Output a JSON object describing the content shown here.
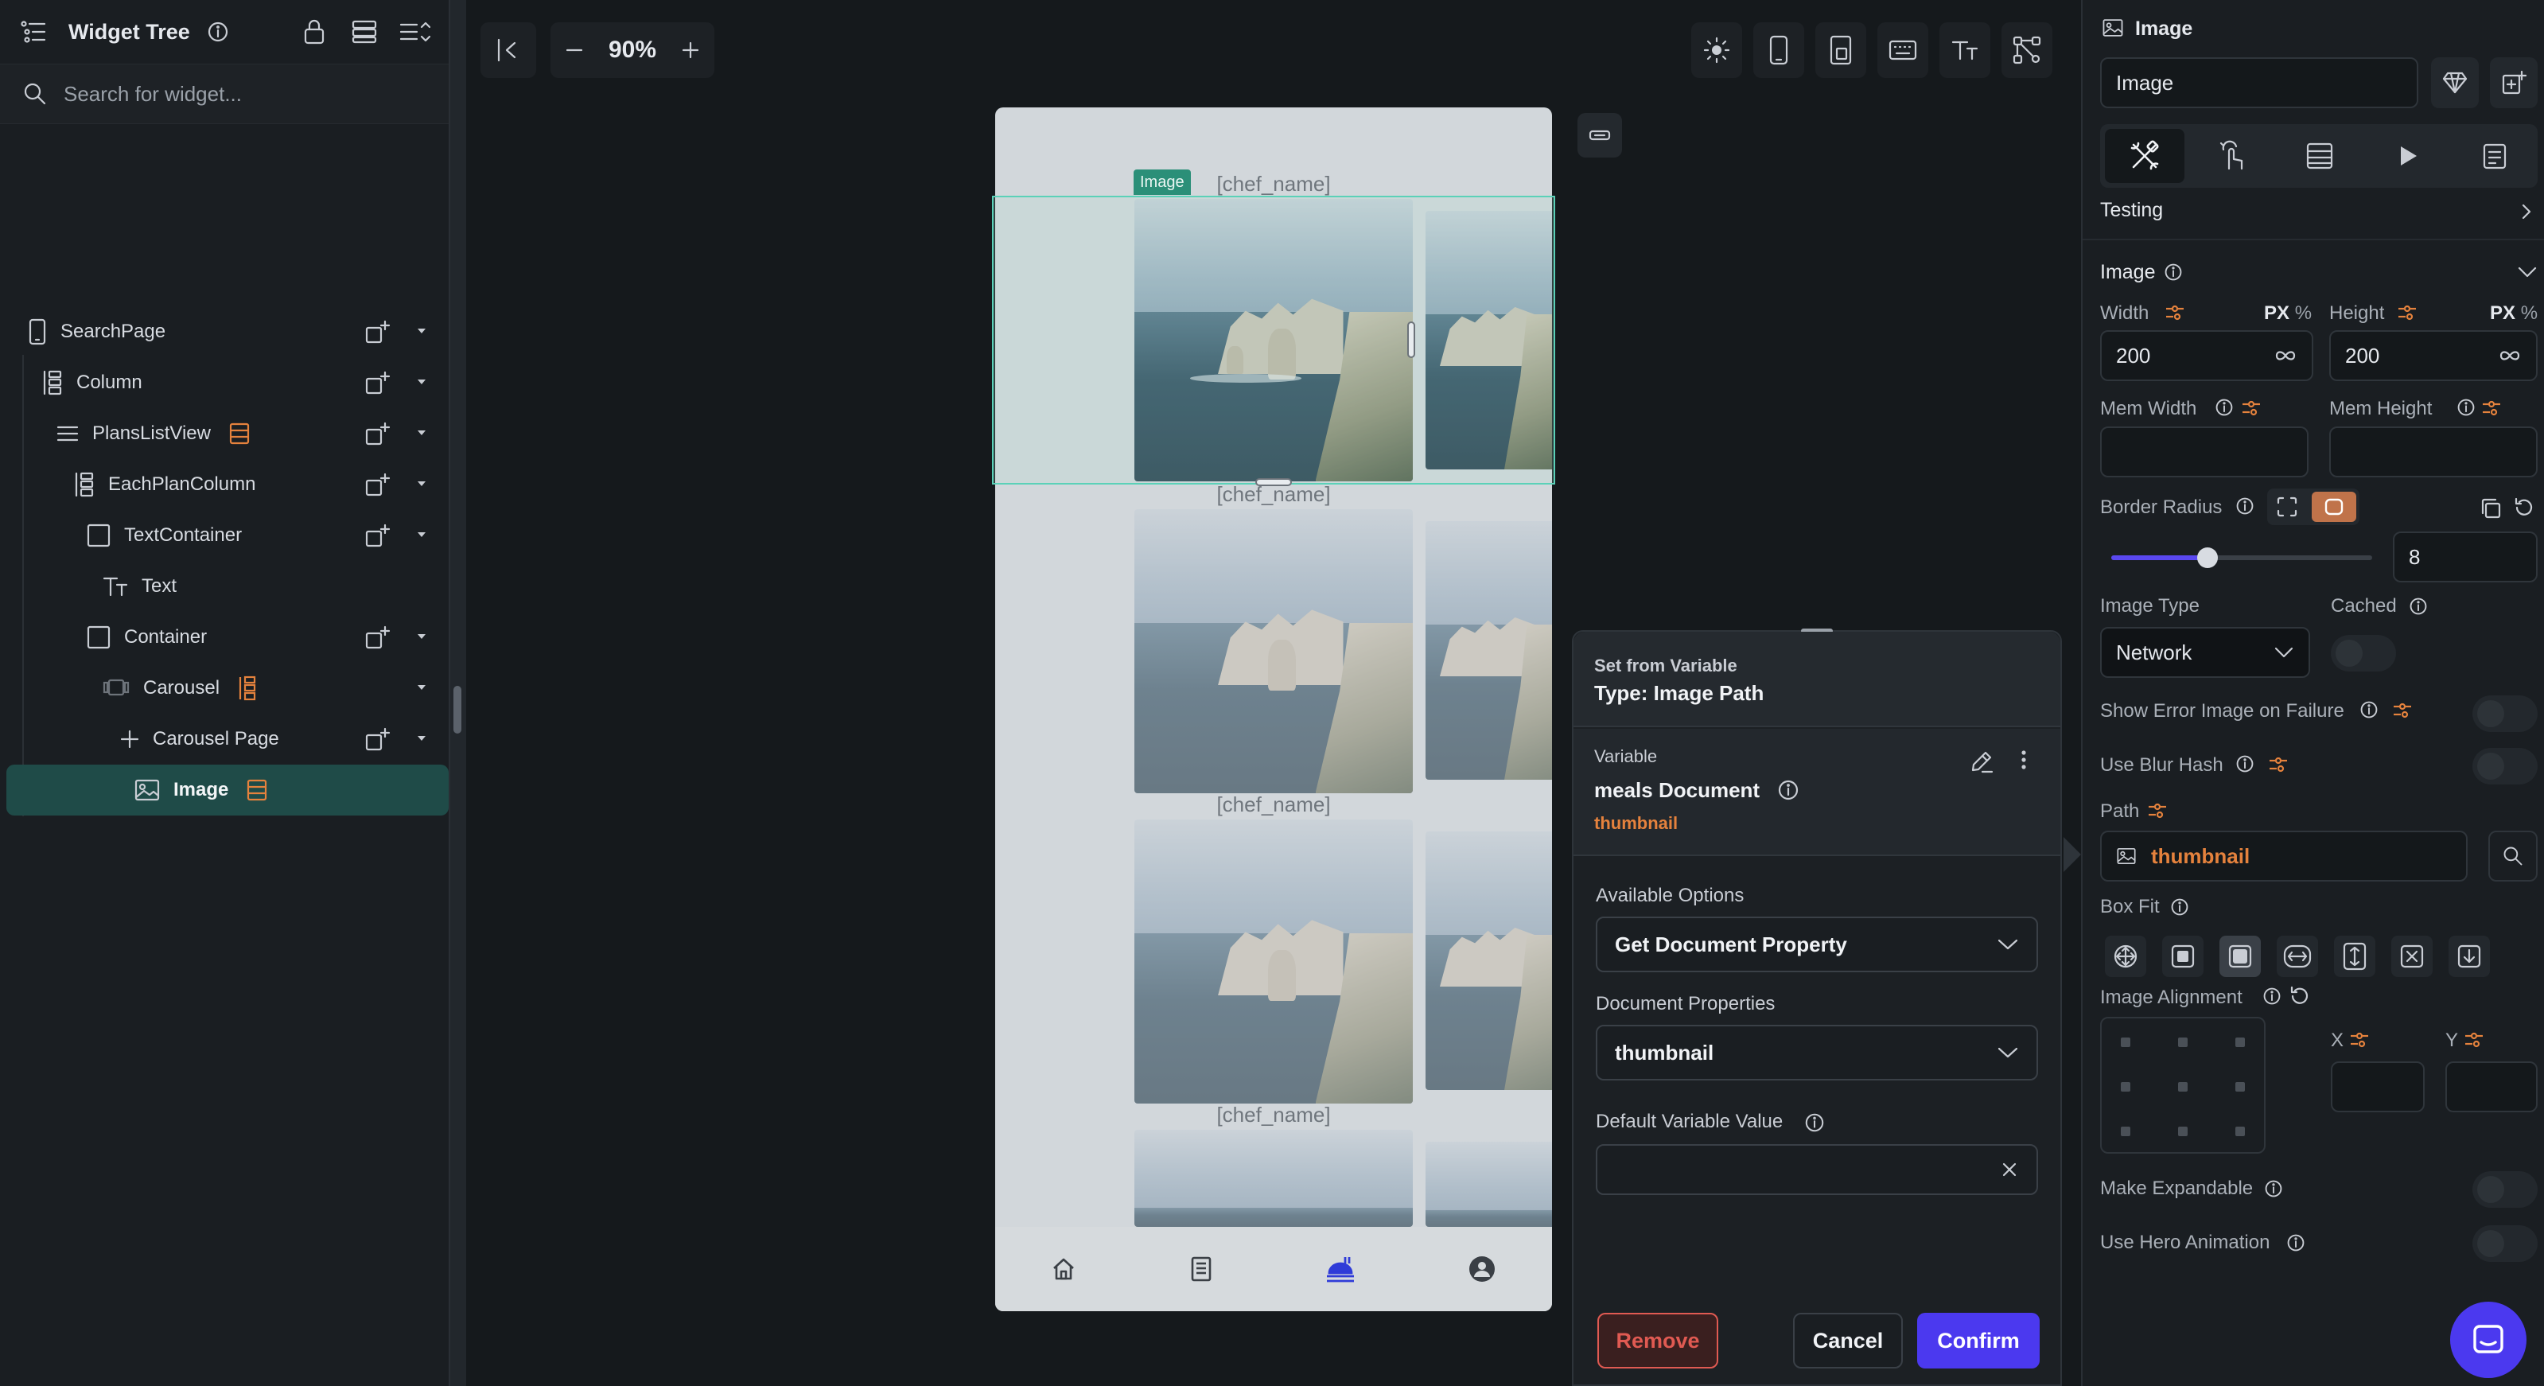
{
  "widget_tree": {
    "title": "Widget Tree",
    "search_placeholder": "Search for widget...",
    "nodes": [
      {
        "label": "SearchPage"
      },
      {
        "label": "Column"
      },
      {
        "label": "PlansListView"
      },
      {
        "label": "EachPlanColumn"
      },
      {
        "label": "TextContainer"
      },
      {
        "label": "Text"
      },
      {
        "label": "Container"
      },
      {
        "label": "Carousel"
      },
      {
        "label": "Carousel Page"
      },
      {
        "label": "Image"
      }
    ]
  },
  "canvas": {
    "zoom": "90%",
    "selected_tag": "Image",
    "chef_labels": [
      "[chef_name]",
      "[chef_name]",
      "[chef_name]",
      "[chef_name]"
    ]
  },
  "popover": {
    "header_small": "Set from Variable",
    "header_type": "Type: Image Path",
    "variable_label": "Variable",
    "variable_name": "meals Document",
    "variable_field": "thumbnail",
    "available_options_label": "Available Options",
    "available_options_value": "Get Document Property",
    "document_properties_label": "Document Properties",
    "document_properties_value": "thumbnail",
    "default_value_label": "Default Variable Value",
    "default_value": "",
    "remove_label": "Remove",
    "cancel_label": "Cancel",
    "confirm_label": "Confirm"
  },
  "properties": {
    "widget_type": "Image",
    "widget_name": "Image",
    "section_testing": "Testing",
    "section_image": "Image",
    "width_label": "Width",
    "height_label": "Height",
    "unit_px": "PX",
    "unit_pct": "%",
    "width_value": "200",
    "height_value": "200",
    "mem_width_label": "Mem Width",
    "mem_height_label": "Mem Height",
    "border_radius_label": "Border Radius",
    "border_radius_value": "8",
    "border_radius_slider": 0.37,
    "image_type_label": "Image Type",
    "image_type_value": "Network",
    "cached_label": "Cached",
    "show_error_label": "Show Error Image on Failure",
    "blur_hash_label": "Use Blur Hash",
    "path_label": "Path",
    "path_value": "thumbnail",
    "box_fit_label": "Box Fit",
    "image_alignment_label": "Image Alignment",
    "x_label": "X",
    "y_label": "Y",
    "make_expandable_label": "Make Expandable",
    "hero_animation_label": "Use Hero Animation"
  },
  "colors": {
    "accent_teal": "#5bd1b8",
    "confirm_blue": "#4b39ef",
    "remove_red": "#e05a52",
    "variable_orange": "#e5823d"
  }
}
